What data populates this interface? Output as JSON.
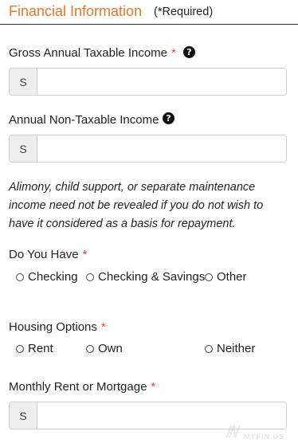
{
  "header": {
    "title": "Financial Information",
    "required_note": "(*Required)"
  },
  "gross_income": {
    "label": "Gross Annual Taxable Income",
    "required_mark": "*",
    "help_icon": "question-circle-icon",
    "addon": "S",
    "value": ""
  },
  "non_taxable_income": {
    "label": "Annual Non-Taxable Income",
    "help_icon": "question-circle-icon",
    "addon": "S",
    "value": ""
  },
  "note": "Alimony, child support, or separate maintenance income need not be revealed if you do not wish to have it considered as a basis for repayment.",
  "accounts": {
    "label": "Do You Have",
    "required_mark": "*",
    "options": [
      "Checking",
      "Checking & Savings",
      "Other"
    ]
  },
  "housing": {
    "label": "Housing Options",
    "required_mark": "*",
    "options": [
      "Rent",
      "Own",
      "Neither"
    ]
  },
  "monthly_payment": {
    "label": "Monthly Rent or Mortgage",
    "required_mark": "*",
    "addon": "S",
    "value": ""
  },
  "watermark": {
    "logo_text": "MYFIN.US"
  },
  "colors": {
    "accent": "#e8762b",
    "required": "#e0463a",
    "border": "#cfcfcf",
    "addon_bg": "#eeeeee"
  }
}
